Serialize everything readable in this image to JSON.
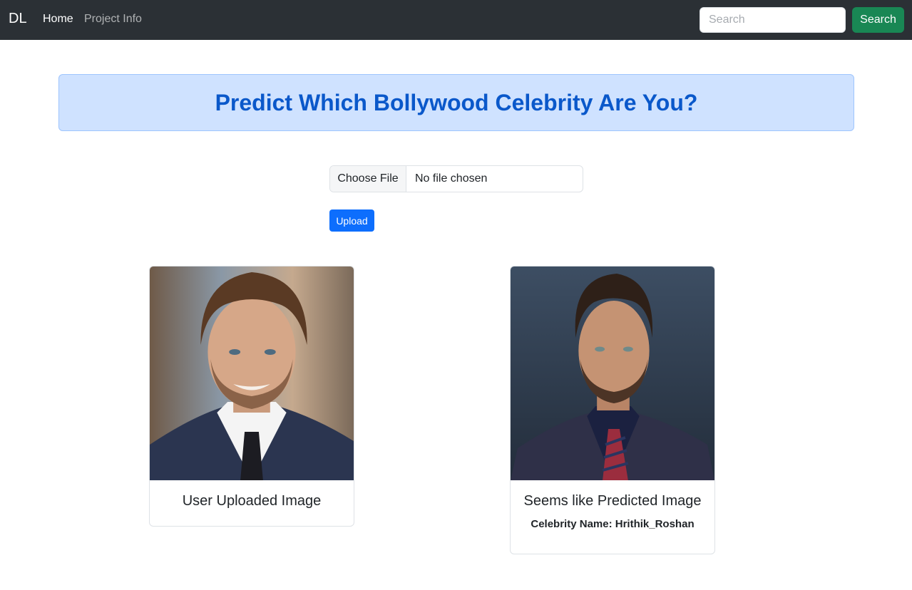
{
  "navbar": {
    "brand": "DL",
    "links": [
      {
        "label": "Home"
      },
      {
        "label": "Project Info"
      }
    ],
    "search_placeholder": "Search",
    "search_button": "Search"
  },
  "header": {
    "title": "Predict Which Bollywood Celebrity Are You?"
  },
  "upload_form": {
    "choose_file_label": "Choose File",
    "file_status": "No file chosen",
    "upload_button": "Upload"
  },
  "cards": {
    "user": {
      "title": "User Uploaded Image"
    },
    "predicted": {
      "title": "Seems like Predicted Image",
      "celebrity_name": "Celebrity Name: Hrithik_Roshan"
    }
  },
  "colors": {
    "navbar_bg": "#2b3035",
    "success": "#198754",
    "primary": "#0d6efd",
    "alert_bg": "#cfe2ff",
    "alert_text": "#0a58ca"
  }
}
